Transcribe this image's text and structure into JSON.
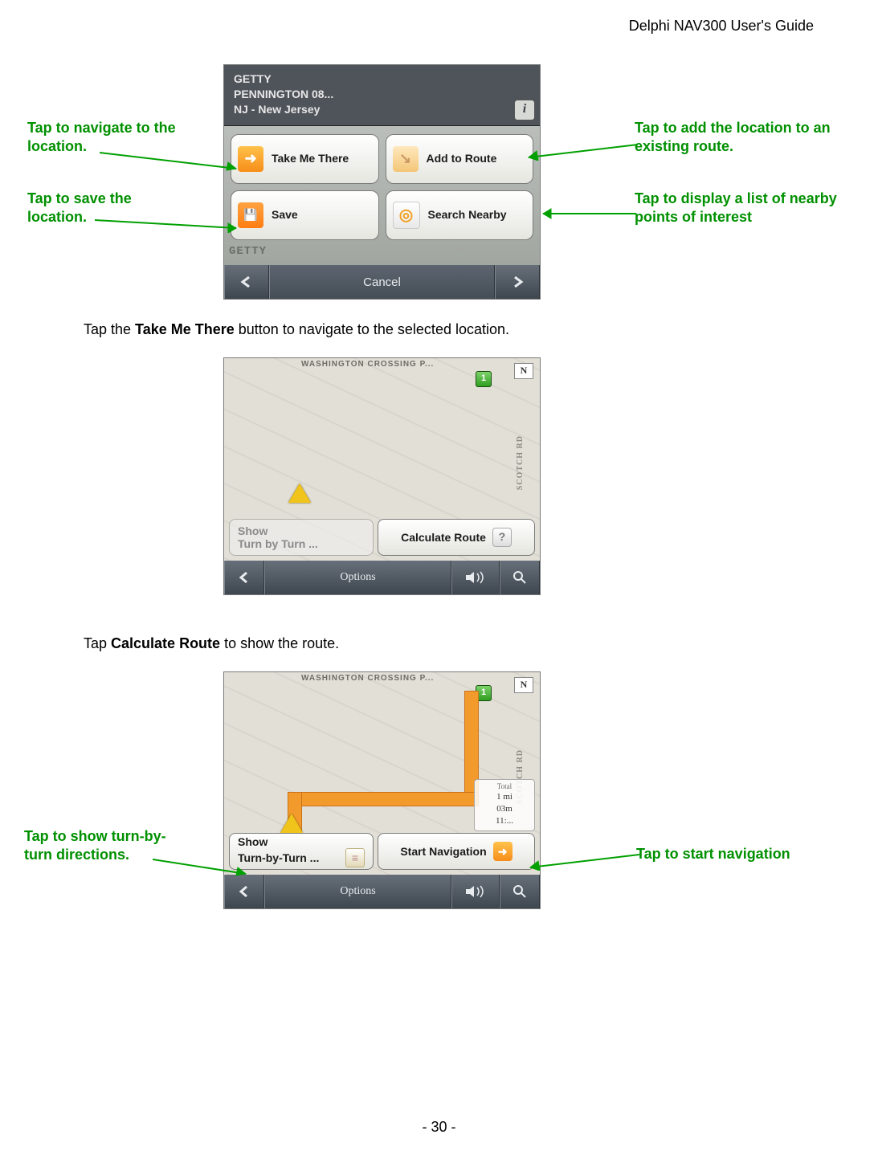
{
  "doc": {
    "header": "Delphi NAV300 User's Guide",
    "footer": "- 30 -"
  },
  "callouts": {
    "nav_to_location": "Tap to navigate to the location.",
    "save_location": "Tap to save the location.",
    "add_to_route": "Tap to add the location to an existing route.",
    "search_nearby": "Tap to display a list of nearby points of interest",
    "show_turn_by_turn": "Tap to show turn-by-turn directions.",
    "start_nav": "Tap to start navigation"
  },
  "paragraphs": {
    "p1_prefix": "Tap the ",
    "p1_bold": "Take Me There",
    "p1_suffix": " button to navigate to the selected location.",
    "p2_prefix": "Tap ",
    "p2_bold": "Calculate Route",
    "p2_suffix": " to show the route."
  },
  "shot1": {
    "poi_name": "GETTY",
    "poi_addr1": "PENNINGTON 08...",
    "poi_addr2": "NJ - New Jersey",
    "faded": "GETTY",
    "btn_take_me": "Take Me There",
    "btn_add_route": "Add to Route",
    "btn_save": "Save",
    "btn_search_nearby": "Search Nearby",
    "cancel": "Cancel"
  },
  "shot2": {
    "top_text": "WASHINGTON CROSSING P...",
    "compass": "N",
    "pin_label": "1",
    "road1": "SCOTCH RD",
    "ghost_line1": "Show",
    "ghost_line2": "Turn by Turn ...",
    "calc_route": "Calculate Route",
    "options": "Options"
  },
  "shot3": {
    "top_text": "WASHINGTON CROSSING P...",
    "compass": "N",
    "pin_label": "1",
    "road1": "SCOTCH RD",
    "total_label": "Total",
    "total_dist": "1 mi",
    "total_time": "03m",
    "total_eta": "11:...",
    "show_tbt_line1": "Show",
    "show_tbt_line2": "Turn-by-Turn ...",
    "start_nav": "Start Navigation",
    "options": "Options"
  }
}
